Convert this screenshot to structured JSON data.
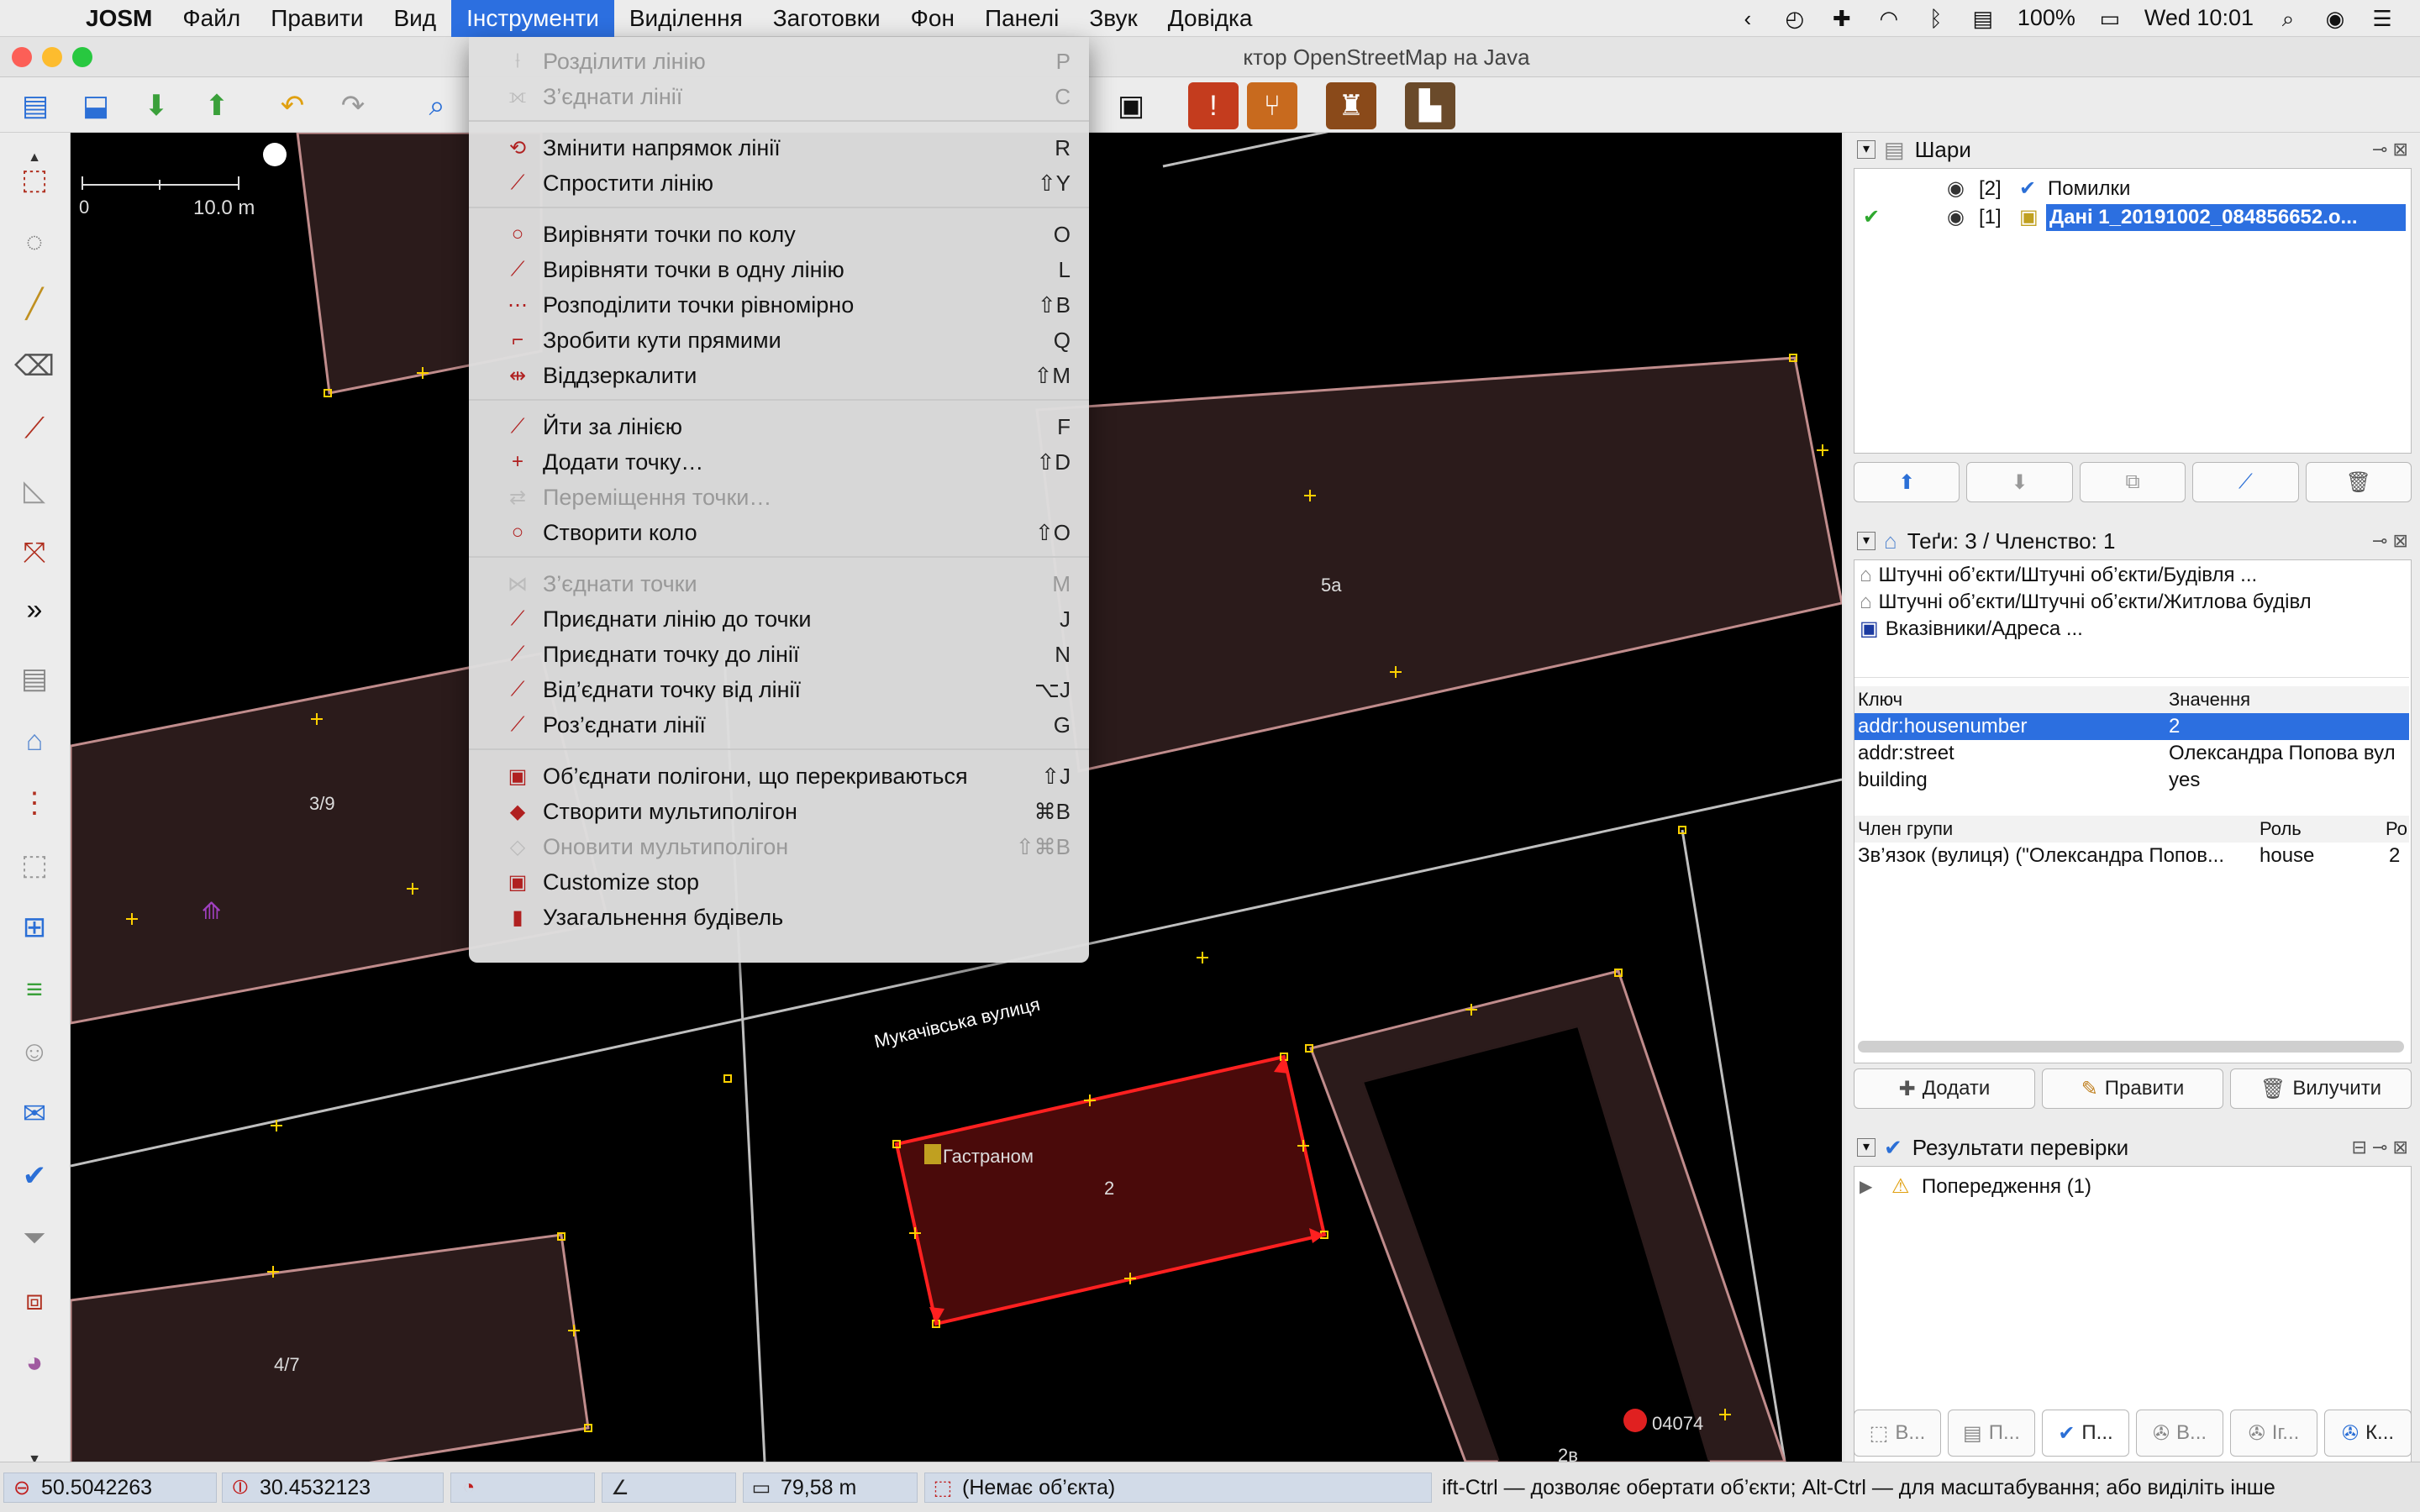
{
  "menubar": {
    "app": "JOSM",
    "items": [
      "Файл",
      "Правити",
      "Вид",
      "Інструменти",
      "Виділення",
      "Заготовки",
      "Фон",
      "Панелі",
      "Звук",
      "Довідка"
    ],
    "battery": "100%",
    "clock": "Wed 10:01"
  },
  "window": {
    "title_fragment": "ктор OpenStreetMap на Java"
  },
  "tools_menu": [
    {
      "label": "Розділити лінію",
      "shortcut": "P",
      "disabled": true
    },
    {
      "label": "З’єднати лінії",
      "shortcut": "C",
      "disabled": true
    },
    {
      "sep": true
    },
    {
      "label": "Змінити напрямок лінії",
      "shortcut": "R"
    },
    {
      "label": "Спростити лінію",
      "shortcut": "⇧Y"
    },
    {
      "sep": true
    },
    {
      "label": "Вирівняти точки по колу",
      "shortcut": "O"
    },
    {
      "label": "Вирівняти точки в одну лінію",
      "shortcut": "L"
    },
    {
      "label": "Розподілити точки рівномірно",
      "shortcut": "⇧B"
    },
    {
      "label": "Зробити кути прямими",
      "shortcut": "Q"
    },
    {
      "label": "Віддзеркалити",
      "shortcut": "⇧M"
    },
    {
      "sep": true
    },
    {
      "label": "Йти за лінією",
      "shortcut": "F"
    },
    {
      "label": "Додати точку…",
      "shortcut": "⇧D"
    },
    {
      "label": "Переміщення точки…",
      "shortcut": "",
      "disabled": true
    },
    {
      "label": "Створити коло",
      "shortcut": "⇧O"
    },
    {
      "sep": true
    },
    {
      "label": "З’єднати точки",
      "shortcut": "M",
      "disabled": true
    },
    {
      "label": "Приєднати лінію до точки",
      "shortcut": "J"
    },
    {
      "label": "Приєднати точку до лінії",
      "shortcut": "N"
    },
    {
      "label": "Від’єднати точку від лінії",
      "shortcut": "⌥J"
    },
    {
      "label": "Роз’єднати лінії",
      "shortcut": "G"
    },
    {
      "sep": true
    },
    {
      "label": "Об’єднати полігони, що перекриваються",
      "shortcut": "⇧J"
    },
    {
      "label": "Створити мультиполігон",
      "shortcut": "⌘B"
    },
    {
      "label": "Оновити мультиполігон",
      "shortcut": "⇧⌘B",
      "disabled": true
    },
    {
      "label": "Customize stop",
      "shortcut": ""
    },
    {
      "label": "Узагальнення будівель",
      "shortcut": ""
    }
  ],
  "map": {
    "scale_zero": "0",
    "scale_label": "10.0 m",
    "labels": {
      "b5a": "5a",
      "b39": "3/9",
      "b47": "4/7",
      "b2": "2",
      "b2v": "2в",
      "street": "Мукачівська вулиця",
      "shop": "Гастраном",
      "post": "04074"
    }
  },
  "layers": {
    "title": "Шари",
    "items": [
      {
        "index": "[2]",
        "name": "Помилки"
      },
      {
        "index": "[1]",
        "name": "Дані 1_20191002_084856652.o..."
      }
    ]
  },
  "tags": {
    "title": "Теґи: 3 / Членство: 1",
    "presets": [
      "Штучні об’єкти/Штучні об’єкти/Будівля ...",
      "Штучні об’єкти/Штучні об’єкти/Житлова будівл",
      "Вказівники/Адреса ..."
    ],
    "col_key": "Ключ",
    "col_value": "Значення",
    "rows": [
      {
        "k": "addr:housenumber",
        "v": "2"
      },
      {
        "k": "addr:street",
        "v": "Олександра Попова вул"
      },
      {
        "k": "building",
        "v": "yes"
      }
    ],
    "member_headers": [
      "Член групи",
      "Роль",
      "Ро"
    ],
    "member_row": {
      "name": "Зв’язок (вулиця) (\"Олександра Попов...",
      "role": "house",
      "pos": "2"
    },
    "buttons": {
      "add": "Додати",
      "edit": "Правити",
      "delete": "Вилучити"
    }
  },
  "validation": {
    "title": "Результати перевірки",
    "item": "Попередження (1)"
  },
  "bottom_tabs": [
    "В...",
    "П...",
    "П...",
    "В...",
    "Іг...",
    "К..."
  ],
  "status": {
    "lat": "50.5042263",
    "lon": "30.4532123",
    "distance": "79,58 m",
    "object": "(Немає об’єкта)",
    "hint": "ift-Ctrl — дозволяє обертати об’єкти; Alt-Ctrl — для масштабування; або виділіть інше"
  },
  "colors": {
    "accent": "#2c6fe0",
    "selected_way": "#ff2020",
    "building_fill": "#2a1a1a",
    "building_outline": "#c89090"
  }
}
